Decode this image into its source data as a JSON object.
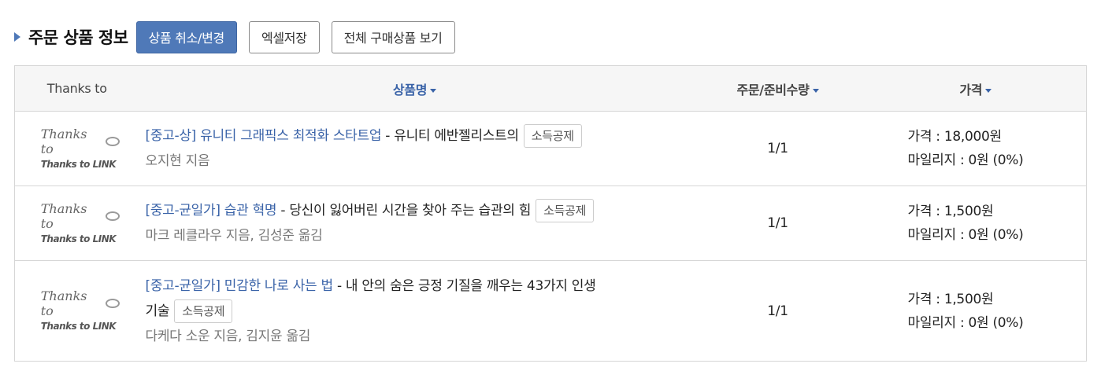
{
  "section": {
    "title": "주문 상품 정보",
    "buttons": {
      "cancel_change": "상품 취소/변경",
      "excel_save": "엑셀저장",
      "view_all": "전체 구매상품 보기"
    }
  },
  "table": {
    "headers": {
      "thanks_to": "Thanks to",
      "product_name": "상품명",
      "quantity": "주문/준비수량",
      "price": "가격"
    },
    "logo": {
      "line1": "Thanks to",
      "line2": "Thanks to LINK"
    },
    "rows": [
      {
        "title_link": "[중고-상] 유니티 그래픽스 최적화 스타트업",
        "subtitle": " - 유니티 에반젤리스트의",
        "subtitle_cont": "",
        "badge": "소득공제",
        "author": "오지현 지음",
        "quantity": "1/1",
        "price": "가격 : 18,000원",
        "mileage": "마일리지 : 0원 (0%)"
      },
      {
        "title_link": "[중고-균일가] 습관 혁명",
        "subtitle": " - 당신이 잃어버린 시간을 찾아 주는 습관의 힘",
        "subtitle_cont": "",
        "badge": "소득공제",
        "author": "마크 레클라우 지음, 김성준 옮김",
        "quantity": "1/1",
        "price": "가격 : 1,500원",
        "mileage": "마일리지 : 0원 (0%)"
      },
      {
        "title_link": "[중고-균일가] 민감한 나로 사는 법",
        "subtitle": " - 내 안의 숨은 긍정 기질을 깨우는 43가지 인생",
        "subtitle_cont": "기술",
        "badge": "소득공제",
        "author": "다케다 소운 지음, 김지윤 옮김",
        "quantity": "1/1",
        "price": "가격 : 1,500원",
        "mileage": "마일리지 : 0원 (0%)"
      }
    ]
  },
  "colors": {
    "accent": "#4f79b8",
    "link": "#3a63a8",
    "border": "#d6d6d6",
    "header_bg": "#f6f6f6"
  }
}
